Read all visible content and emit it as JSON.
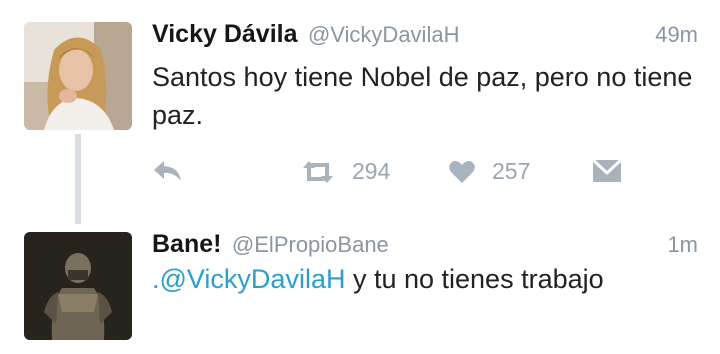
{
  "tweets": [
    {
      "name": "Vicky Dávila",
      "handle": "@VickyDavilaH",
      "time": "49m",
      "text": "Santos hoy tiene Nobel de paz, pero no tiene paz.",
      "actions": {
        "reply_icon": "reply-icon",
        "retweet_icon": "retweet-icon",
        "retweet_count": "294",
        "like_icon": "heart-icon",
        "like_count": "257",
        "dm_icon": "envelope-icon"
      }
    },
    {
      "name": "Bane!",
      "handle": "@ElPropioBane",
      "time": "1m",
      "text_mention": ".@VickyDavilaH",
      "text_rest": " y tu no tienes trabajo"
    }
  ],
  "colors": {
    "mention": "#2b9fcc",
    "meta_gray": "#8a97a3",
    "action_gray": "#a8b3bd",
    "thread_line": "#d8dde1"
  }
}
